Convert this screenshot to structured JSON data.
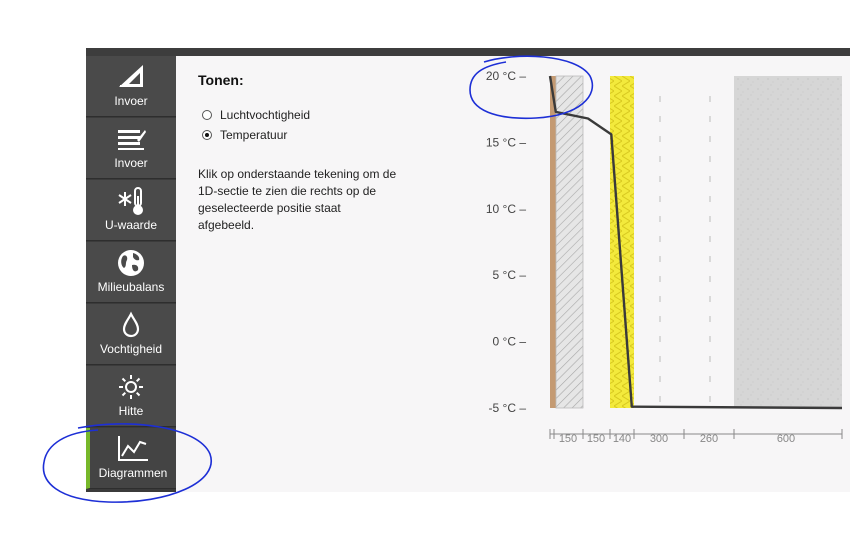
{
  "sidebar": {
    "items": [
      {
        "label": "Invoer",
        "icon": "set-square-ruler-icon"
      },
      {
        "label": "Invoer",
        "icon": "layers-list-icon"
      },
      {
        "label": "U-waarde",
        "icon": "snowflake-thermometer-icon"
      },
      {
        "label": "Milieubalans",
        "icon": "globe-icon"
      },
      {
        "label": "Vochtigheid",
        "icon": "droplet-icon"
      },
      {
        "label": "Hitte",
        "icon": "sun-icon"
      },
      {
        "label": "Diagrammen",
        "icon": "line-chart-icon",
        "active": true
      }
    ]
  },
  "panel": {
    "title": "Tonen:",
    "options": [
      {
        "label": "Luchtvochtigheid",
        "selected": false
      },
      {
        "label": "Temperatuur",
        "selected": true
      }
    ],
    "help": "Klik op onderstaande tekening om de 1D-sectie te zien die rechts op de geselecteerde positie staat afgebeeld."
  },
  "chart_data": {
    "type": "line",
    "ylabel": "",
    "xlabel": "",
    "ylim": [
      -5,
      20
    ],
    "y_ticks": [
      "20 °C –",
      "15 °C –",
      "10 °C –",
      "5 °C –",
      "0 °C –",
      "-5 °C –"
    ],
    "y_tick_values": [
      20,
      15,
      10,
      5,
      0,
      -5
    ],
    "layers": [
      {
        "thickness_label": "150",
        "material": "wood"
      },
      {
        "thickness_label": "150",
        "material": "hatched"
      },
      {
        "thickness_label": "140",
        "material": "insulation"
      },
      {
        "thickness_label": "300",
        "material": "cavity"
      },
      {
        "thickness_label": "260",
        "material": "cavity"
      },
      {
        "thickness_label": "600",
        "material": "concrete"
      }
    ],
    "series": [
      {
        "x": [
          0,
          0.02,
          0.13,
          0.21,
          0.28,
          1.0
        ],
        "y": [
          20,
          17.3,
          16.8,
          15.6,
          -4.9,
          -5.0
        ]
      }
    ],
    "colors": {
      "line": "#3a3a3a",
      "wood": "#c49a72",
      "insulation": "#f3ea3c",
      "concrete": "#d5d5d5",
      "hatch": "#9a9a9a",
      "annotation": "#1d2fd6"
    }
  }
}
